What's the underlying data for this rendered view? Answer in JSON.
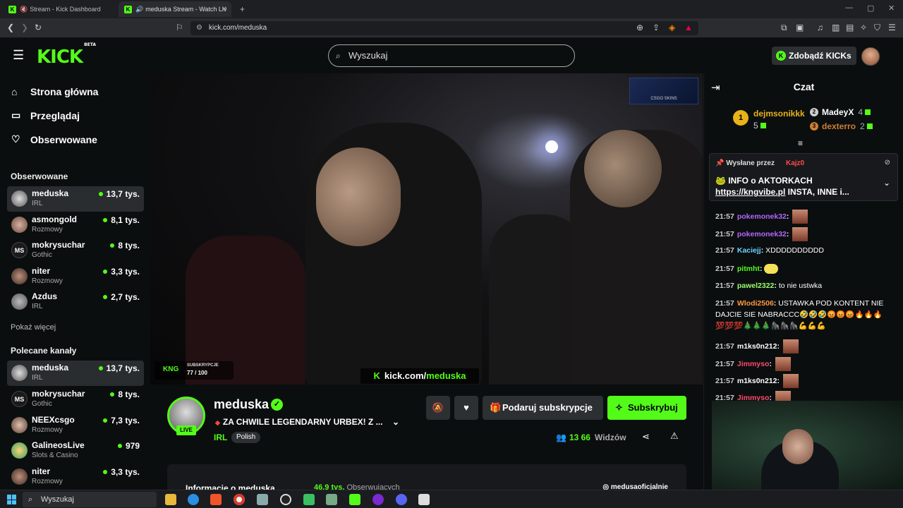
{
  "browser": {
    "tabs": [
      {
        "label": "Stream - Kick Dashboard",
        "active": false
      },
      {
        "label": "meduska Stream - Watch Liv",
        "active": true
      }
    ],
    "new_tab": "+",
    "url": "kick.com/meduska"
  },
  "header": {
    "logo": "KICK",
    "logo_badge": "BETA",
    "search_placeholder": "Wyszukaj",
    "kicks_button": "Zdobądź KICKs"
  },
  "sidebar": {
    "nav": [
      {
        "label": "Strona główna",
        "icon": "home-icon"
      },
      {
        "label": "Przeglądaj",
        "icon": "browse-icon"
      },
      {
        "label": "Obserwowane",
        "icon": "heart-icon"
      }
    ],
    "followed_title": "Obserwowane",
    "followed": [
      {
        "name": "meduska",
        "category": "IRL",
        "viewers": "13,7 tys.",
        "selected": true,
        "initials": ""
      },
      {
        "name": "asmongold",
        "category": "Rozmowy",
        "viewers": "8,1 tys.",
        "initials": ""
      },
      {
        "name": "mokrysuchar",
        "category": "Gothic",
        "viewers": "8 tys.",
        "initials": "MS"
      },
      {
        "name": "niter",
        "category": "Rozmowy",
        "viewers": "3,3 tys.",
        "initials": ""
      },
      {
        "name": "Azdus",
        "category": "IRL",
        "viewers": "2,7 tys.",
        "initials": ""
      }
    ],
    "show_more": "Pokaż więcej",
    "recommended_title": "Polecane kanały",
    "recommended": [
      {
        "name": "meduska",
        "category": "IRL",
        "viewers": "13,7 tys.",
        "selected": true,
        "initials": ""
      },
      {
        "name": "mokrysuchar",
        "category": "Gothic",
        "viewers": "8 tys.",
        "initials": "MS"
      },
      {
        "name": "NEEXcsgo",
        "category": "Rozmowy",
        "viewers": "7,3 tys.",
        "initials": ""
      },
      {
        "name": "GalineosLive",
        "category": "Slots & Casino",
        "viewers": "979",
        "initials": ""
      },
      {
        "name": "niter",
        "category": "Rozmowy",
        "viewers": "3,3 tys.",
        "initials": ""
      }
    ]
  },
  "video": {
    "sub_goal_label": "SUBSKRYPCJE",
    "sub_goal_progress": "77 / 100",
    "watermark_prefix": "kick.com/",
    "watermark_channel": "meduska",
    "ad_text": "CSGO SKINS"
  },
  "stream": {
    "channel": "meduska",
    "live_badge": "LIVE",
    "title": "ZA CHWILE LEGENDARNY URBEX! Z ...",
    "category": "IRL",
    "language": "Polish",
    "gift_button": "Podaruj subskrypcje",
    "subscribe_button": "Subskrybuj",
    "viewers": "13 66",
    "viewers_label": "Widzów",
    "about_title": "Informacje o meduska",
    "followers": "46,9 tys.",
    "followers_label": "Obserwujących",
    "instagram": "medusaoficjalnie"
  },
  "chat": {
    "title": "Czat",
    "leaderboard": [
      {
        "rank": "1",
        "name": "dejmsonikkk",
        "count": "5"
      },
      {
        "rank": "2",
        "name": "MadeyX",
        "count": "4"
      },
      {
        "rank": "3",
        "name": "dexterro",
        "count": "2"
      }
    ],
    "pinned": {
      "by_label": "Wysłane przez",
      "by_user": "Kajz0",
      "line1": "INFO o AKTORKACH",
      "link": "https://kngvibe.pl",
      "line2_rest": " INSTA, INNE i..."
    },
    "messages": [
      {
        "time": "21:57",
        "user": "pokemonek32",
        "color": "#b466ff",
        "text": "",
        "emote": true
      },
      {
        "time": "21:57",
        "user": "pokemonek32",
        "color": "#b466ff",
        "text": "",
        "emote": true
      },
      {
        "time": "21:57",
        "user": "Kaciejj",
        "color": "#6ad4ff",
        "text": "XDDDDDDDDDD",
        "emote": false
      },
      {
        "time": "21:57",
        "user": "pitmht",
        "color": "#53fc18",
        "text": "",
        "emote": false
      },
      {
        "time": "21:57",
        "user": "pawel2322",
        "color": "#9bff6a",
        "text": "to nie ustwka",
        "emote": false
      },
      {
        "time": "21:57",
        "user": "Wlodi2506",
        "color": "#ff9a3c",
        "text": "USTAWKA POD KONTENT NIE DAJCIE SIE NABRACCC🤣🤣🤣😡😡😡🔥🔥🔥 💯💯💯🎄🎄🎄🦍🦍🦍💪💪💪",
        "emote": false
      },
      {
        "time": "21:57",
        "user": "m1ks0n212",
        "color": "#ffffff",
        "text": "",
        "emote": true
      },
      {
        "time": "21:57",
        "user": "Jimmyso",
        "color": "#ff4a6a",
        "text": "",
        "emote": true
      },
      {
        "time": "21:57",
        "user": "m1ks0n212",
        "color": "#ffffff",
        "text": "",
        "emote": true
      },
      {
        "time": "21:57",
        "user": "Jimmyso",
        "color": "#ff4a6a",
        "text": "",
        "emote": true
      }
    ]
  },
  "taskbar": {
    "search_placeholder": "Wyszukaj"
  },
  "colors": {
    "accent": "#53fc18",
    "background": "#0b0e0f",
    "panel": "#2d3033"
  }
}
